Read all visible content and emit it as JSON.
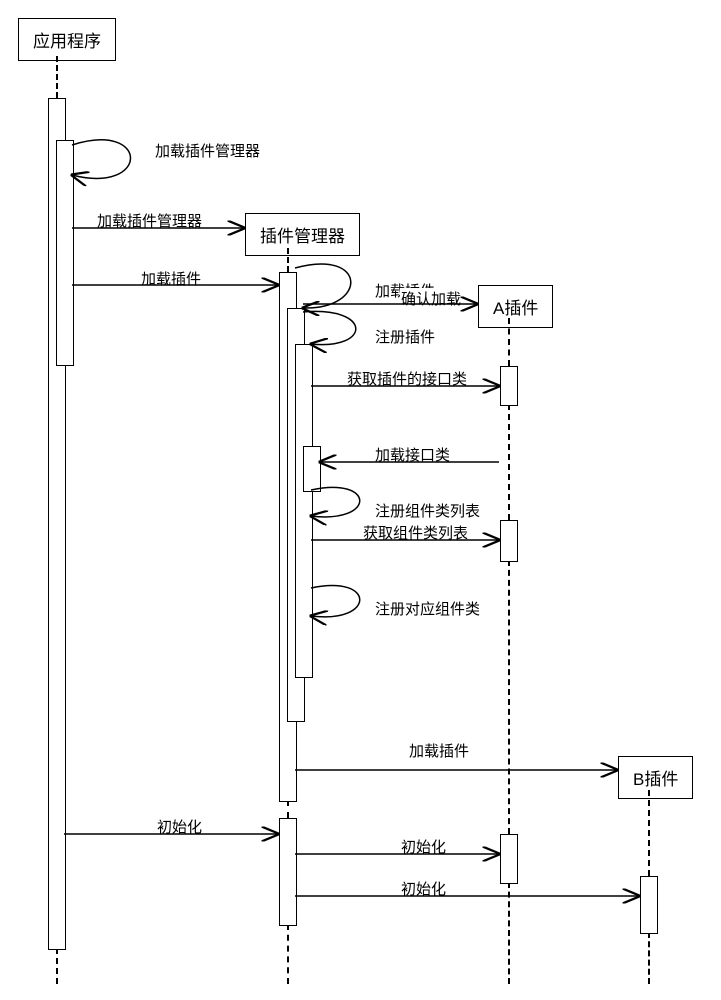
{
  "participants": {
    "app": "应用程序",
    "manager": "插件管理器",
    "pluginA": "A插件",
    "pluginB": "B插件"
  },
  "messages": {
    "loadPluginManagerSelf": "加载插件管理器",
    "loadPluginManager": "加载插件管理器",
    "loadPlugin": "加载插件",
    "loadPluginSelf": "加载插件",
    "confirmLoad": "确认加载",
    "registerPlugin": "注册插件",
    "getPluginInterface": "获取插件的接口类",
    "loadInterface": "加载接口类",
    "registerComponentList": "注册组件类列表",
    "getComponentList": "获取组件类列表",
    "registerCorrespondingComponent": "注册对应组件类",
    "loadPluginB": "加载插件",
    "initialize": "初始化",
    "initializeA": "初始化",
    "initializeB": "初始化"
  }
}
